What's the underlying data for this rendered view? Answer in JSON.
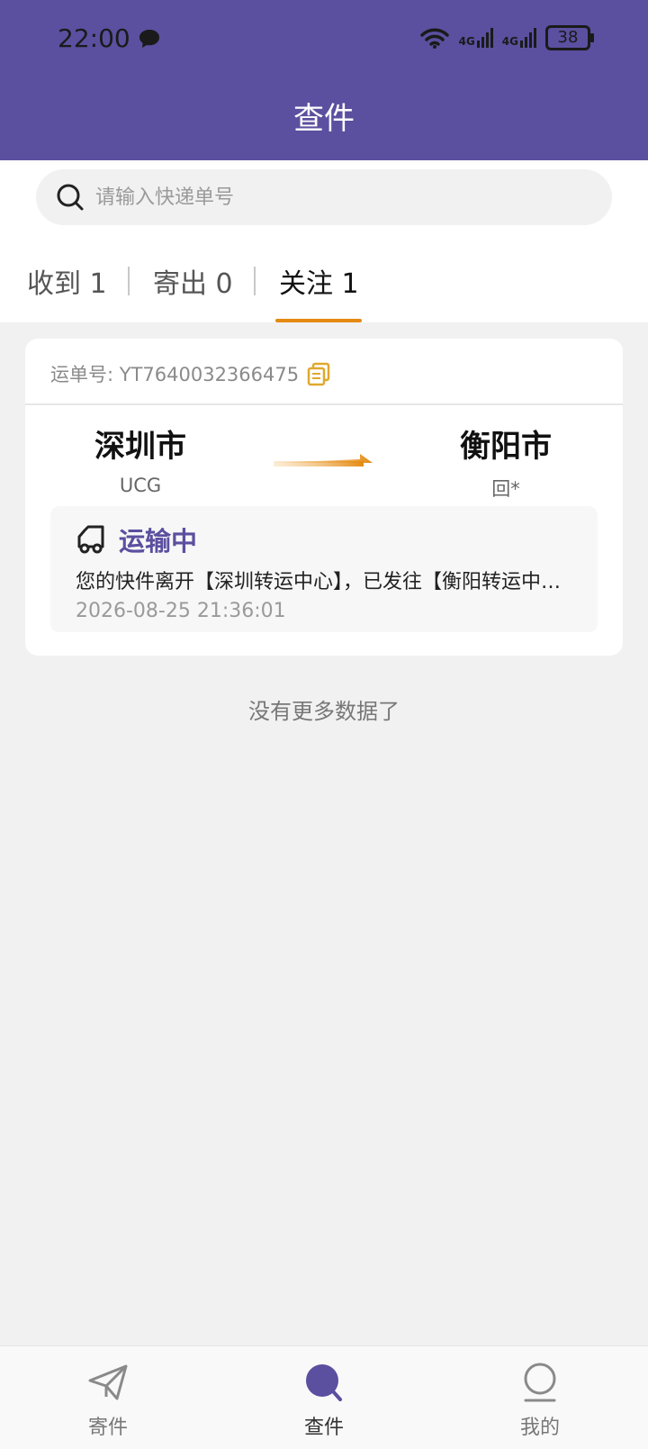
{
  "status_bar": {
    "time": "22:00",
    "network_1": "4G",
    "network_2": "4G",
    "battery": "38"
  },
  "header": {
    "title": "查件"
  },
  "search": {
    "placeholder": "请输入快递单号"
  },
  "tabs": [
    {
      "label": "收到 1"
    },
    {
      "label": "寄出 0"
    },
    {
      "label": "关注 1"
    }
  ],
  "shipment": {
    "waybill_label": "运单号: YT7640032366475",
    "origin_city": "深圳市",
    "origin_sub": "UCG",
    "destination_city": "衡阳市",
    "destination_sub": "回*",
    "status": "运输中",
    "description": "您的快件离开【深圳转运中心】，已发往【衡阳转运中心】",
    "timestamp": "2026-08-25 21:36:01"
  },
  "list_footer": {
    "no_more": "没有更多数据了"
  },
  "bottom_nav": [
    {
      "label": "寄件",
      "icon": "send-icon"
    },
    {
      "label": "查件",
      "icon": "search-icon"
    },
    {
      "label": "我的",
      "icon": "profile-icon"
    }
  ],
  "colors": {
    "primary": "#5b4f9f",
    "accent": "#e58a12",
    "copy_icon": "#e0a82e"
  }
}
